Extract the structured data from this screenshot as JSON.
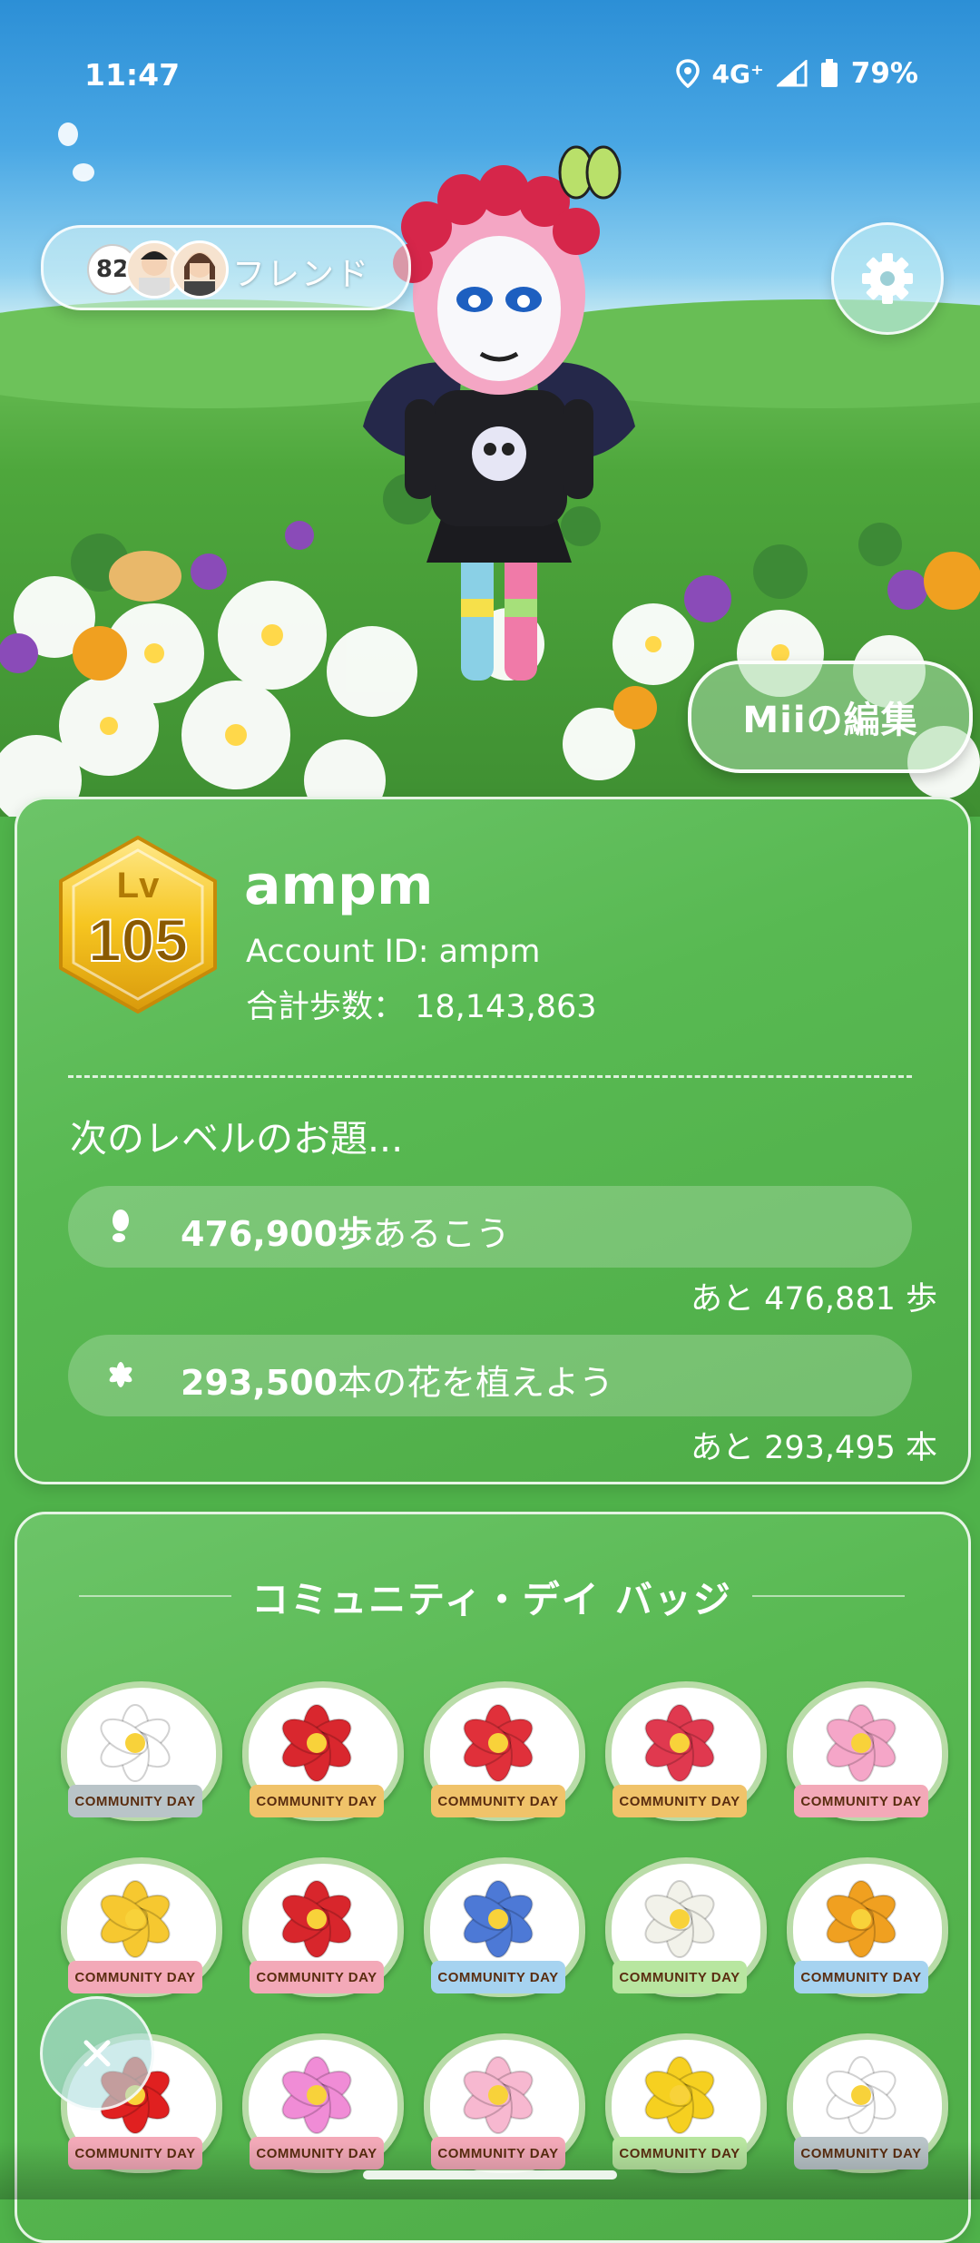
{
  "status_bar": {
    "time": "11:47",
    "network": "4G⁺",
    "battery": "79%"
  },
  "friends": {
    "count": "82",
    "label": "フレンド"
  },
  "mii_edit_label": "Miiの編集",
  "profile": {
    "level_prefix": "Lv",
    "level": "105",
    "name": "ampm",
    "account_id": "Account ID: ampm",
    "total_steps": "合計歩数：  18,143,863"
  },
  "next_level": {
    "title": "次のレベルのお題...",
    "tasks": [
      {
        "icon": "footprint-icon",
        "amount": "476,900歩",
        "text": "あるこう",
        "remaining": "あと 476,881 歩"
      },
      {
        "icon": "flower-icon",
        "amount": "293,500",
        "text": "本の花を植えよう",
        "remaining": "あと 293,495 本"
      }
    ]
  },
  "badges": {
    "title": "コミュニティ・デイ バッジ",
    "ribbon_label": "COMMUNITY DAY",
    "items": [
      {
        "name": "white-flower",
        "color": "#ffffff",
        "ribbon": "#b9c4c8"
      },
      {
        "name": "poinsettia",
        "color": "#d9272e",
        "ribbon": "#f0c36a"
      },
      {
        "name": "camellia",
        "color": "#e0303a",
        "ribbon": "#f0c36a"
      },
      {
        "name": "red-flower",
        "color": "#e0394f",
        "ribbon": "#f0c36a"
      },
      {
        "name": "cherry-blossom",
        "color": "#f5a6c8",
        "ribbon": "#f3a9b8"
      },
      {
        "name": "tulip",
        "color": "#f6c830",
        "ribbon": "#f3a9b8"
      },
      {
        "name": "rose",
        "color": "#d8262c",
        "ribbon": "#f3a9b8"
      },
      {
        "name": "hydrangea",
        "color": "#4d79d6",
        "ribbon": "#a6d3f0"
      },
      {
        "name": "lily",
        "color": "#f2f2ea",
        "ribbon": "#b8e6a0"
      },
      {
        "name": "sunflower",
        "color": "#f0a020",
        "ribbon": "#a6d3f0"
      },
      {
        "name": "red-spider-lily",
        "color": "#e02020",
        "ribbon": "#f3a9b8"
      },
      {
        "name": "cosmos",
        "color": "#f08cd6",
        "ribbon": "#f3a9b8"
      },
      {
        "name": "pink-tulip",
        "color": "#f7b8d0",
        "ribbon": "#f3a9b8"
      },
      {
        "name": "daffodil",
        "color": "#f6d020",
        "ribbon": "#b8e6a0"
      },
      {
        "name": "white-rose",
        "color": "#ffffff",
        "ribbon": "#b9c4c8"
      }
    ]
  }
}
